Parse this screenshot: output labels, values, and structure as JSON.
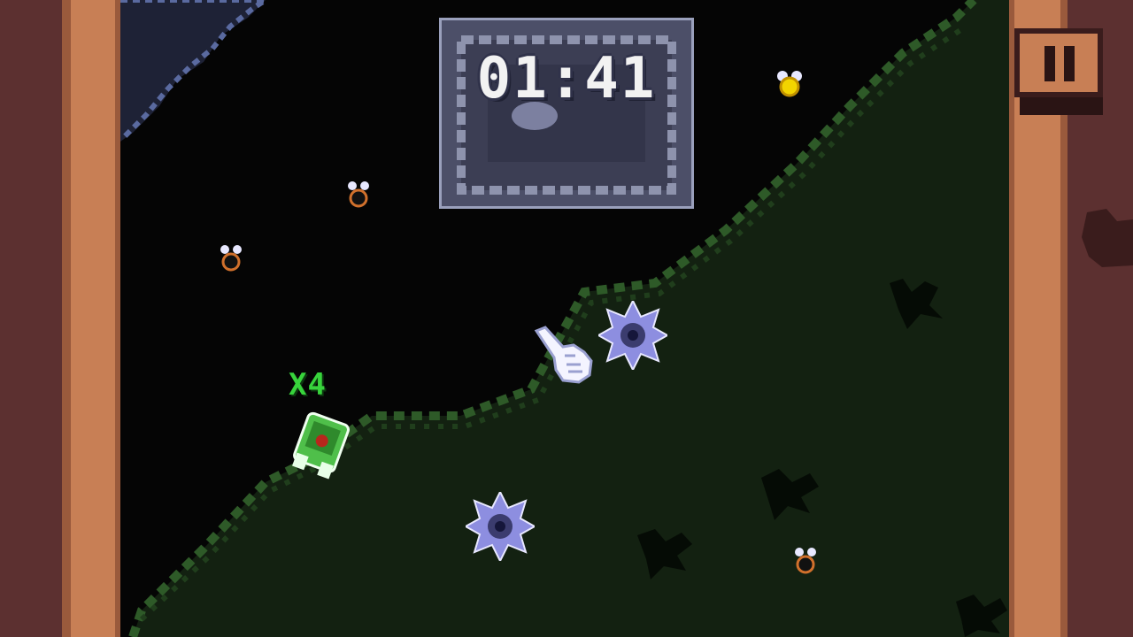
{
  "hud": {
    "timer": "01:41",
    "multiplier": "X4",
    "pause_icon": "pause-icon"
  },
  "colors": {
    "grass": "#132111",
    "grass_edge": "#2e5a28",
    "dark_ground": "#050505",
    "dirt_wall": "#5c3030",
    "dirt_edge": "#c87f55",
    "player": "#4fbf4a",
    "spike_mine": "#8d8ee0",
    "timer_panel": "#4c4f68"
  },
  "icons": [
    "pause-icon",
    "pointer-hand-icon",
    "spike-mine-icon",
    "fly-icon",
    "player-tank-icon"
  ]
}
